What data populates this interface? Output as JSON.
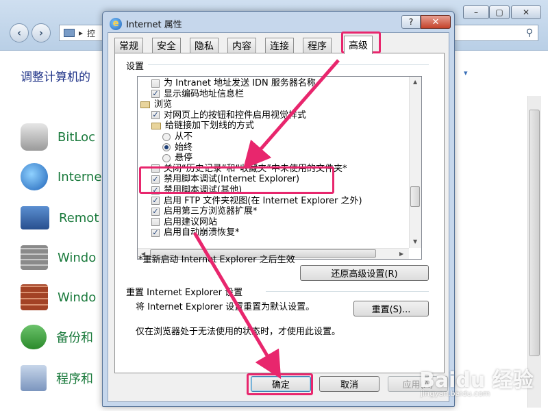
{
  "background_window": {
    "breadcrumb": "控",
    "heading": "调整计算机的",
    "items": [
      {
        "label": "BitLoc"
      },
      {
        "label": "Interne"
      },
      {
        "label": "Remot"
      },
      {
        "label": "Windo"
      },
      {
        "label": "Windo"
      },
      {
        "label": "备份和"
      },
      {
        "label": "程序和"
      }
    ]
  },
  "dialog": {
    "title": "Internet 属性",
    "help": "?",
    "close": "✕",
    "tabs": [
      "常规",
      "安全",
      "隐私",
      "内容",
      "连接",
      "程序",
      "高级"
    ],
    "active_tab": "高级",
    "settings_label": "设置",
    "tree": [
      {
        "kind": "chk",
        "checked": false,
        "indent": 1,
        "label": "为 Intranet 地址发送 IDN 服务器名称"
      },
      {
        "kind": "chk",
        "checked": true,
        "indent": 1,
        "label": "显示编码地址信息栏"
      },
      {
        "kind": "folder",
        "indent": 0,
        "label": "浏览"
      },
      {
        "kind": "chk",
        "checked": true,
        "indent": 1,
        "label": "对网页上的按钮和控件启用视觉样式"
      },
      {
        "kind": "folder",
        "indent": 1,
        "label": "给链接加下划线的方式"
      },
      {
        "kind": "radio",
        "checked": false,
        "indent": 2,
        "label": "从不"
      },
      {
        "kind": "radio",
        "checked": true,
        "indent": 2,
        "label": "始终"
      },
      {
        "kind": "radio",
        "checked": false,
        "indent": 2,
        "label": "悬停"
      },
      {
        "kind": "chk",
        "checked": false,
        "indent": 1,
        "label": "关闭“历史记录”和“收藏夹”中未使用的文件夹*"
      },
      {
        "kind": "chk",
        "checked": true,
        "indent": 1,
        "label": "禁用脚本调试(Internet Explorer)"
      },
      {
        "kind": "chk",
        "checked": true,
        "indent": 1,
        "label": "禁用脚本调试(其他)"
      },
      {
        "kind": "chk",
        "checked": true,
        "indent": 1,
        "label": "启用 FTP 文件夹视图(在 Internet Explorer 之外)"
      },
      {
        "kind": "chk",
        "checked": true,
        "indent": 1,
        "label": "启用第三方浏览器扩展*"
      },
      {
        "kind": "chk",
        "checked": false,
        "indent": 1,
        "label": "启用建议网站"
      },
      {
        "kind": "chk",
        "checked": true,
        "indent": 1,
        "label": "启用自动崩溃恢复*"
      }
    ],
    "restart_note": "*重新启动 Internet Explorer 之后生效",
    "restore_advanced_button": "还原高级设置(R)",
    "reset_group_label": "重置 Internet Explorer 设置",
    "reset_desc": "将 Internet Explorer 设置重置为默认设置。",
    "reset_button": "重置(S)...",
    "reset_note": "仅在浏览器处于无法使用的状态时，才使用此设置。",
    "ok_button": "确定",
    "cancel_button": "取消",
    "apply_button": "应用(A)"
  },
  "watermark": {
    "main": "Baidu 经验",
    "sub": "jingyan.baidu.com"
  },
  "colors": {
    "highlight": "#e8266d",
    "dialog_frame": "#c6d7ec",
    "link_green": "#1a7a3c",
    "heading_blue": "#1e3287"
  }
}
